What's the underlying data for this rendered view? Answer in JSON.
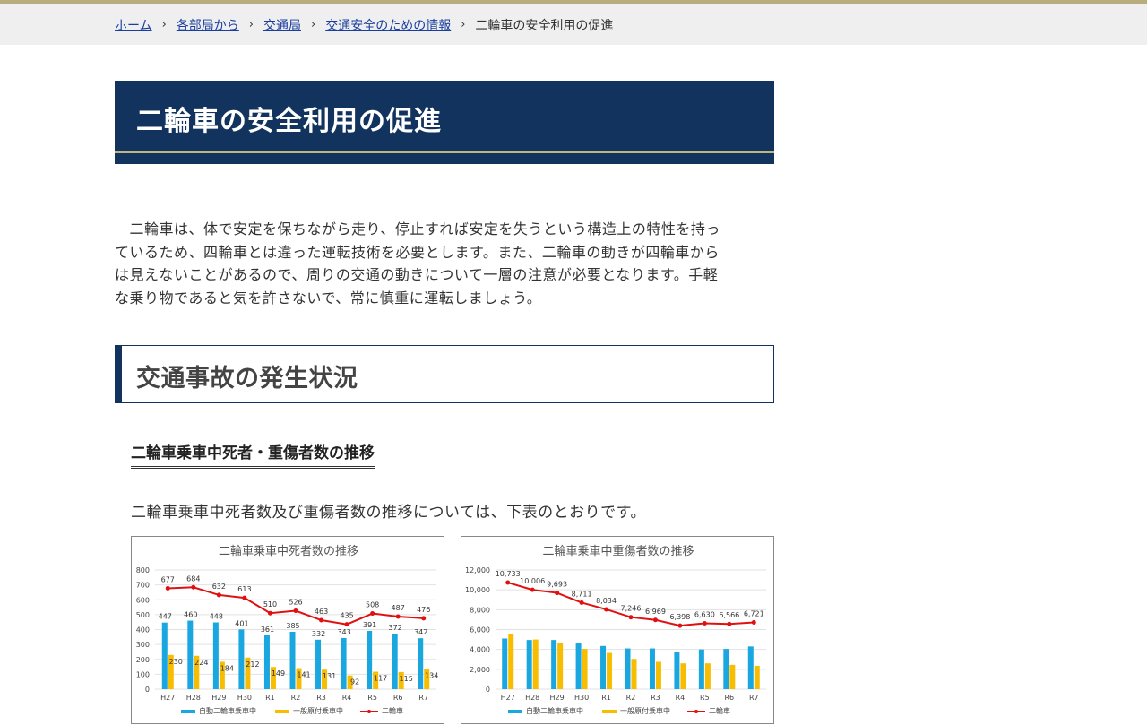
{
  "breadcrumb": {
    "items": [
      "ホーム",
      "各部局から",
      "交通局",
      "交通安全のための情報"
    ],
    "current": "二輪車の安全利用の促進"
  },
  "page_title": "二輪車の安全利用の促進",
  "intro_lines": [
    "　二輪車は、体で安定を保ちながら走り、停止すれば安定を失うという構造上の特性を持っ",
    "ているため、四輪車とは違った運転技術を必要とします。また、二輪車の動きが四輪車から",
    "は見えないことがあるので、周りの交通の動きについて一層の注意が必要となります。手軽",
    "な乗り物であると気を許さないで、常に慎重に運転しましょう。"
  ],
  "section_heading": "交通事故の発生状況",
  "subheading": "二輪車乗車中死者・重傷者数の推移",
  "sentence": "二輪車乗車中死者数及び重傷者数の推移については、下表のとおりです。",
  "colors": {
    "motorcycle": "#1aa7e0",
    "moped": "#f8bd00",
    "total": "#e01010"
  },
  "chart_data": [
    {
      "type": "bar",
      "title": "二輪車乗車中死者数の推移",
      "categories": [
        "H27",
        "H28",
        "H29",
        "H30",
        "R1",
        "R2",
        "R3",
        "R4",
        "R5",
        "R6",
        "R7"
      ],
      "ylim": [
        0,
        800
      ],
      "yticks": [
        "0",
        "100",
        "200",
        "300",
        "400",
        "500",
        "600",
        "700",
        "800"
      ],
      "series": [
        {
          "name": "自動二輪車乗車中",
          "kind": "bar",
          "values": [
            447,
            460,
            448,
            401,
            361,
            385,
            332,
            343,
            391,
            372,
            342
          ]
        },
        {
          "name": "一般原付乗車中",
          "kind": "bar",
          "values": [
            230,
            224,
            184,
            212,
            149,
            141,
            131,
            92,
            117,
            115,
            134
          ]
        },
        {
          "name": "二輪車",
          "kind": "line",
          "values": [
            677,
            684,
            632,
            613,
            510,
            526,
            463,
            435,
            508,
            487,
            476
          ]
        }
      ]
    },
    {
      "type": "bar",
      "title": "二輪車乗車中重傷者数の推移",
      "categories": [
        "H27",
        "H28",
        "H29",
        "H30",
        "R1",
        "R2",
        "R3",
        "R4",
        "R5",
        "R6",
        "R7"
      ],
      "ylim": [
        0,
        12000
      ],
      "yticks": [
        "0",
        "2,000",
        "4,000",
        "6,000",
        "8,000",
        "10,000",
        "12,000"
      ],
      "series": [
        {
          "name": "自動二輪車乗車中",
          "kind": "bar",
          "values": [
            5100,
            4950,
            4950,
            4600,
            4350,
            4100,
            4100,
            3750,
            4000,
            4050,
            4300
          ]
        },
        {
          "name": "一般原付乗車中",
          "kind": "bar",
          "values": [
            5600,
            5000,
            4700,
            4050,
            3650,
            3050,
            2750,
            2600,
            2600,
            2450,
            2350
          ]
        },
        {
          "name": "二輪車",
          "kind": "line",
          "values": [
            10733,
            10006,
            9693,
            8711,
            8034,
            7246,
            6969,
            6398,
            6630,
            6566,
            6721
          ],
          "labels": [
            "10,733",
            "10,006",
            "9,693",
            "8,711",
            "8,034",
            "7,246",
            "6,969",
            "6,398",
            "6,630",
            "6,566",
            "6,721"
          ]
        }
      ]
    }
  ]
}
